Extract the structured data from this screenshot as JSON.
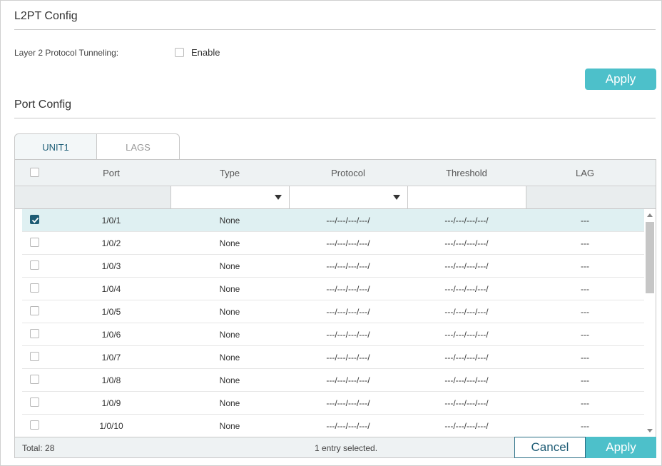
{
  "l2pt": {
    "title": "L2PT Config",
    "tunneling_label": "Layer 2 Protocol Tunneling:",
    "enable_label": "Enable",
    "enable_checked": false,
    "apply_label": "Apply"
  },
  "port_config": {
    "title": "Port Config",
    "tabs": [
      {
        "label": "UNIT1",
        "active": true
      },
      {
        "label": "LAGS",
        "active": false
      }
    ],
    "columns": [
      "Port",
      "Type",
      "Protocol",
      "Threshold",
      "LAG"
    ],
    "rows": [
      {
        "port": "1/0/1",
        "type": "None",
        "protocol": "---/---/---/---/",
        "threshold": "---/---/---/---/",
        "lag": "---",
        "checked": true
      },
      {
        "port": "1/0/2",
        "type": "None",
        "protocol": "---/---/---/---/",
        "threshold": "---/---/---/---/",
        "lag": "---",
        "checked": false
      },
      {
        "port": "1/0/3",
        "type": "None",
        "protocol": "---/---/---/---/",
        "threshold": "---/---/---/---/",
        "lag": "---",
        "checked": false
      },
      {
        "port": "1/0/4",
        "type": "None",
        "protocol": "---/---/---/---/",
        "threshold": "---/---/---/---/",
        "lag": "---",
        "checked": false
      },
      {
        "port": "1/0/5",
        "type": "None",
        "protocol": "---/---/---/---/",
        "threshold": "---/---/---/---/",
        "lag": "---",
        "checked": false
      },
      {
        "port": "1/0/6",
        "type": "None",
        "protocol": "---/---/---/---/",
        "threshold": "---/---/---/---/",
        "lag": "---",
        "checked": false
      },
      {
        "port": "1/0/7",
        "type": "None",
        "protocol": "---/---/---/---/",
        "threshold": "---/---/---/---/",
        "lag": "---",
        "checked": false
      },
      {
        "port": "1/0/8",
        "type": "None",
        "protocol": "---/---/---/---/",
        "threshold": "---/---/---/---/",
        "lag": "---",
        "checked": false
      },
      {
        "port": "1/0/9",
        "type": "None",
        "protocol": "---/---/---/---/",
        "threshold": "---/---/---/---/",
        "lag": "---",
        "checked": false
      },
      {
        "port": "1/0/10",
        "type": "None",
        "protocol": "---/---/---/---/",
        "threshold": "---/---/---/---/",
        "lag": "---",
        "checked": false
      }
    ],
    "footer": {
      "total": "Total: 28",
      "selected": "1 entry selected.",
      "cancel_label": "Cancel",
      "apply_label": "Apply"
    }
  },
  "colors": {
    "accent": "#4dc0ca",
    "dark_accent": "#1d5b74",
    "selected_row": "#dff0f2"
  }
}
